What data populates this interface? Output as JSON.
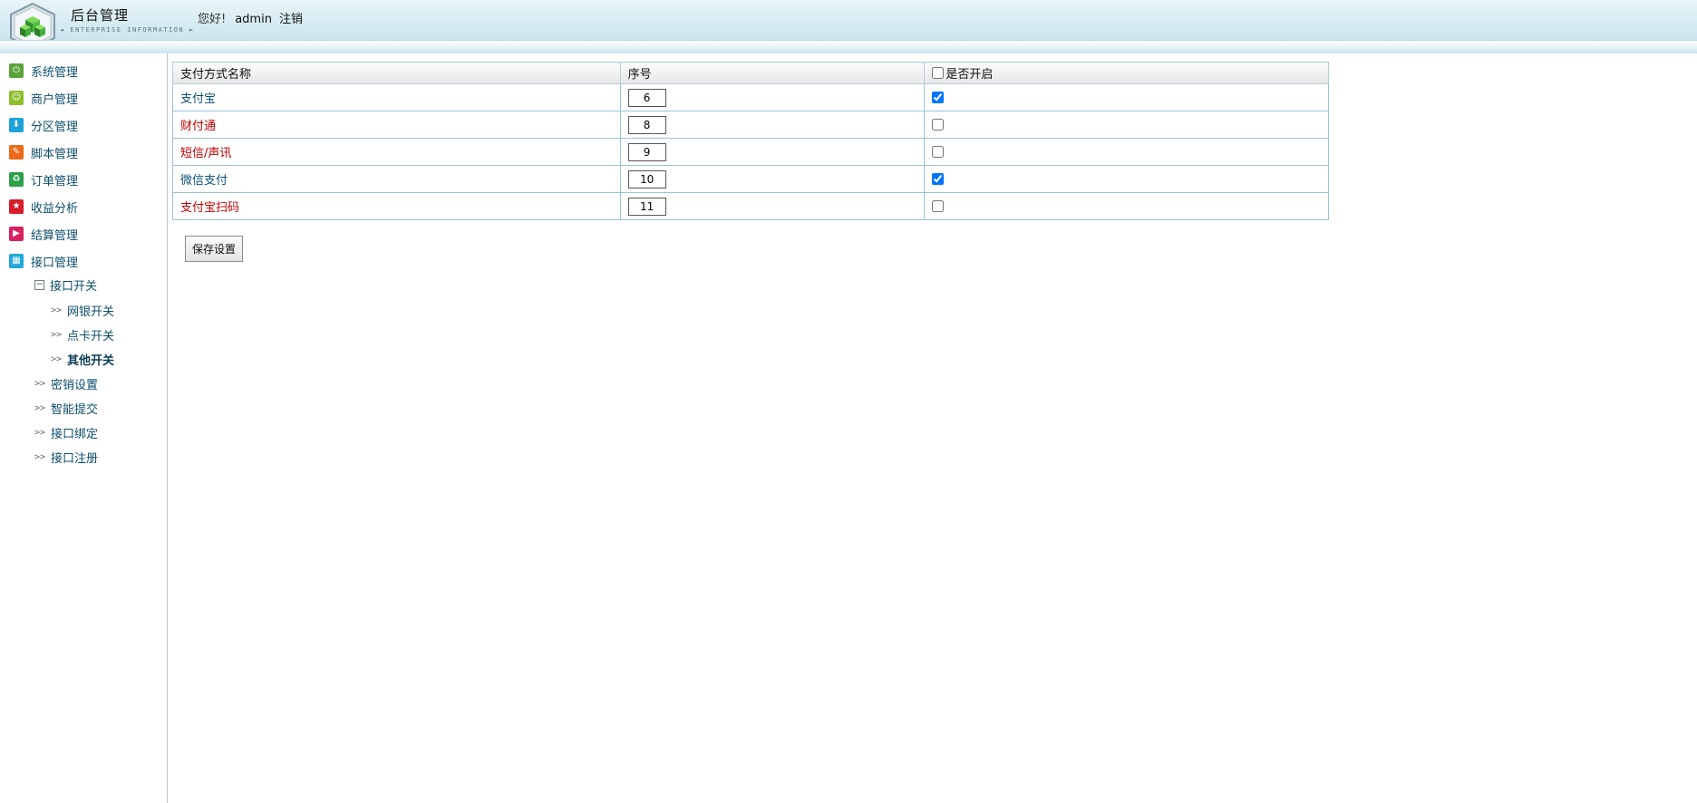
{
  "header": {
    "title": "后台管理",
    "subtitle": "◄ ENTERPRISE INFORMATION ►",
    "hello": "您好!",
    "username": "admin",
    "logout": "注销"
  },
  "sidebar": {
    "menu": [
      {
        "label": "系统管理",
        "icon": "power-icon",
        "color": "#5aa43a"
      },
      {
        "label": "商户管理",
        "icon": "smile-icon",
        "color": "#8cbf2a"
      },
      {
        "label": "分区管理",
        "icon": "download-icon",
        "color": "#1da2d8"
      },
      {
        "label": "脚本管理",
        "icon": "pencil-icon",
        "color": "#ef6a1a"
      },
      {
        "label": "订单管理",
        "icon": "recycle-icon",
        "color": "#2e9f4a"
      },
      {
        "label": "收益分析",
        "icon": "star-icon",
        "color": "#d61d2a"
      },
      {
        "label": "结算管理",
        "icon": "play-icon",
        "color": "#d8215f"
      },
      {
        "label": "接口管理",
        "icon": "grid-icon",
        "color": "#22a9d6"
      }
    ],
    "submenu_open": "接口开关",
    "submenu_items": [
      {
        "label": "网银开关"
      },
      {
        "label": "点卡开关"
      },
      {
        "label": "其他开关"
      }
    ],
    "other_items": [
      {
        "label": "密销设置"
      },
      {
        "label": "智能提交"
      },
      {
        "label": "接口绑定"
      },
      {
        "label": "接口注册"
      }
    ],
    "arrow": ">>"
  },
  "table": {
    "headers": {
      "name": "支付方式名称",
      "order": "序号",
      "enabled": "是否开启"
    },
    "rows": [
      {
        "name": "支付宝",
        "order": "6",
        "enabled": true,
        "color": "blue"
      },
      {
        "name": "财付通",
        "order": "8",
        "enabled": false,
        "color": "red"
      },
      {
        "name": "短信/声讯",
        "order": "9",
        "enabled": false,
        "color": "red"
      },
      {
        "name": "微信支付",
        "order": "10",
        "enabled": true,
        "color": "blue"
      },
      {
        "name": "支付宝扫码",
        "order": "11",
        "enabled": false,
        "color": "red"
      }
    ]
  },
  "actions": {
    "save": "保存设置"
  }
}
